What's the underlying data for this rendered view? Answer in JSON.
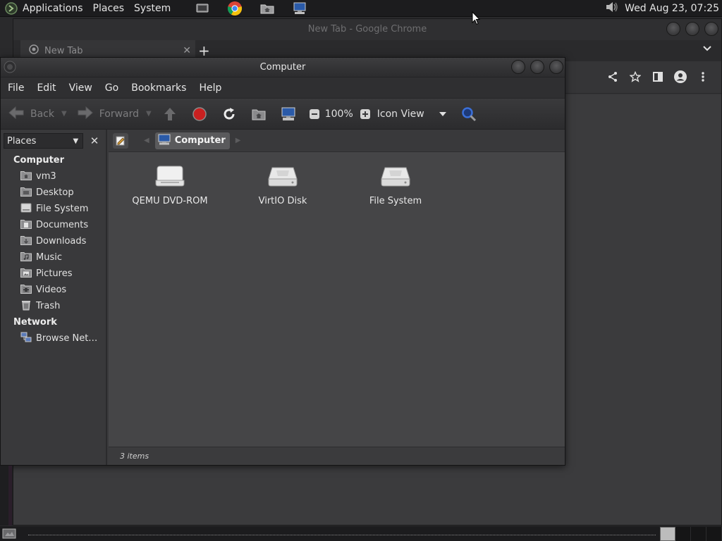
{
  "top_panel": {
    "menus": [
      "Applications",
      "Places",
      "System"
    ],
    "clock": "Wed Aug 23, 07:25"
  },
  "chrome": {
    "window_title": "New Tab - Google Chrome",
    "tab_title": "New Tab",
    "new_tab_label": "+"
  },
  "file_manager": {
    "window_title": "Computer",
    "menubar": [
      "File",
      "Edit",
      "View",
      "Go",
      "Bookmarks",
      "Help"
    ],
    "toolbar": {
      "back_label": "Back",
      "forward_label": "Forward",
      "zoom": "100%",
      "view_mode": "Icon View"
    },
    "sidebar": {
      "selector": "Places",
      "computer_heading": "Computer",
      "items": [
        {
          "label": "vm3",
          "icon": "home-folder-icon"
        },
        {
          "label": "Desktop",
          "icon": "folder-icon"
        },
        {
          "label": "File System",
          "icon": "drive-icon"
        },
        {
          "label": "Documents",
          "icon": "folder-icon"
        },
        {
          "label": "Downloads",
          "icon": "folder-icon"
        },
        {
          "label": "Music",
          "icon": "music-folder-icon"
        },
        {
          "label": "Pictures",
          "icon": "pictures-folder-icon"
        },
        {
          "label": "Videos",
          "icon": "videos-folder-icon"
        },
        {
          "label": "Trash",
          "icon": "trash-icon"
        }
      ],
      "network_heading": "Network",
      "network_items": [
        {
          "label": "Browse Net…",
          "icon": "network-icon"
        }
      ]
    },
    "pathbar": {
      "current": "Computer"
    },
    "items": [
      {
        "name": "QEMU DVD-ROM",
        "icon": "optical-drive-icon"
      },
      {
        "name": "VirtIO Disk",
        "icon": "hard-disk-icon"
      },
      {
        "name": "File System",
        "icon": "hard-disk-icon"
      }
    ],
    "status": "3 items"
  },
  "colors": {
    "panel_bg": "#1c1c1e",
    "window_bg": "#3a3a3c",
    "content_bg": "#454547",
    "stop_red": "#c82020",
    "search_blue": "#3a6fd8"
  }
}
